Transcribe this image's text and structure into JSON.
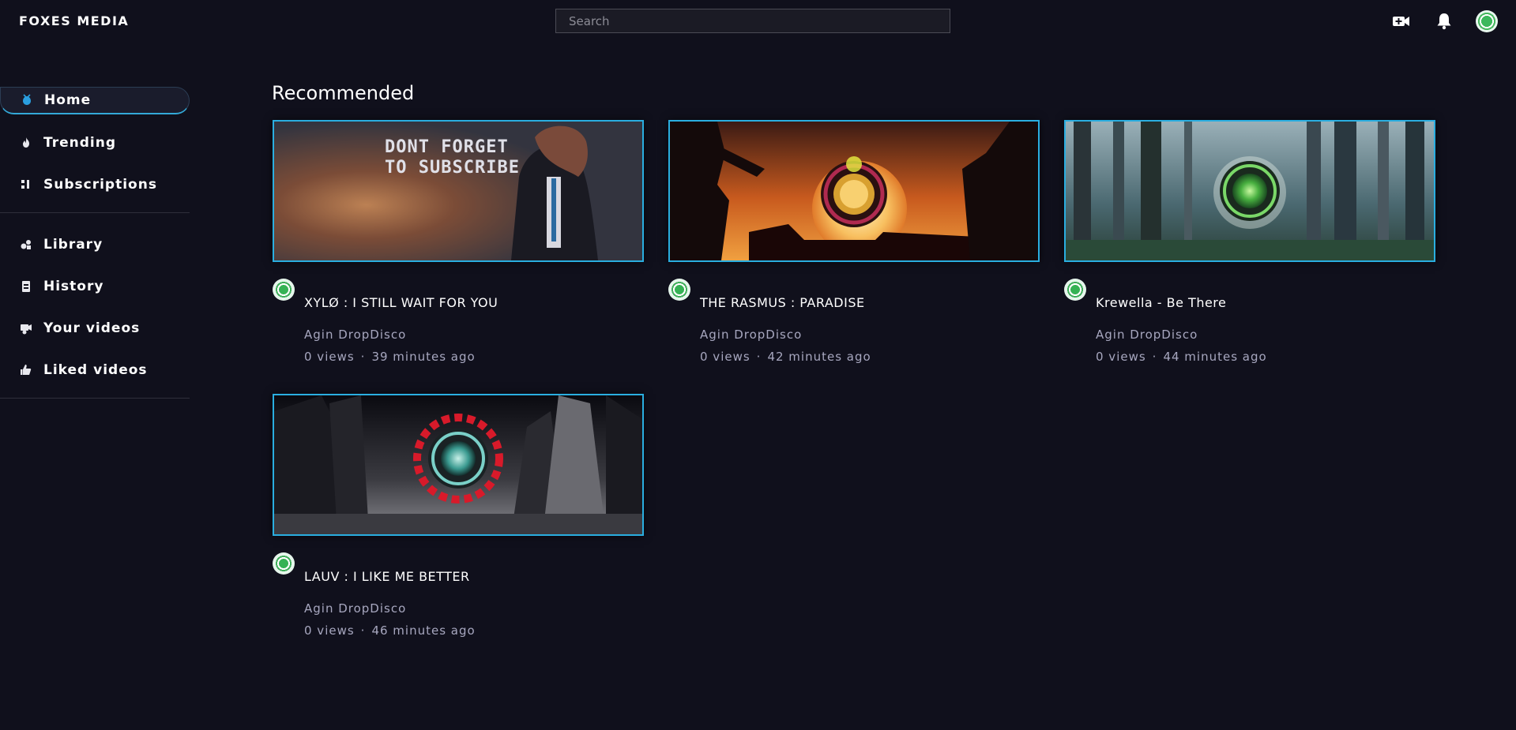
{
  "header": {
    "logo": "FOXES MEDIA",
    "search_placeholder": "Search",
    "icons": [
      "video-add-icon",
      "bell-icon",
      "user-avatar"
    ]
  },
  "sidebar": {
    "items": [
      {
        "label": "Home",
        "icon": "home-icon",
        "active": true
      },
      {
        "label": "Trending",
        "icon": "fire-icon"
      },
      {
        "label": "Subscriptions",
        "icon": "subscriptions-icon"
      },
      {
        "label": "Library",
        "icon": "library-icon"
      },
      {
        "label": "History",
        "icon": "history-icon"
      },
      {
        "label": "Your videos",
        "icon": "your-videos-icon"
      },
      {
        "label": "Liked videos",
        "icon": "liked-icon"
      }
    ]
  },
  "main": {
    "section_title": "Recommended",
    "videos": [
      {
        "title": "XYLØ : I STILL WAIT FOR YOU",
        "channel": "Agin DropDisco",
        "views": "0 views",
        "age": "39 minutes ago",
        "thumb_text": [
          "DONT FORGET",
          "TO SUBSCRIBE"
        ]
      },
      {
        "title": "THE RASMUS : PARADISE",
        "channel": "Agin DropDisco",
        "views": "0 views",
        "age": "42 minutes ago"
      },
      {
        "title": "Krewella - Be There",
        "channel": "Agin DropDisco",
        "views": "0 views",
        "age": "44 minutes ago"
      },
      {
        "title": "LAUV : I LIKE ME BETTER",
        "channel": "Agin DropDisco",
        "views": "0 views",
        "age": "46 minutes ago"
      }
    ],
    "meta_separator": "·"
  },
  "colors": {
    "background": "#10101c",
    "accent": "#2aaee0",
    "muted_text": "#a7a7bf"
  }
}
